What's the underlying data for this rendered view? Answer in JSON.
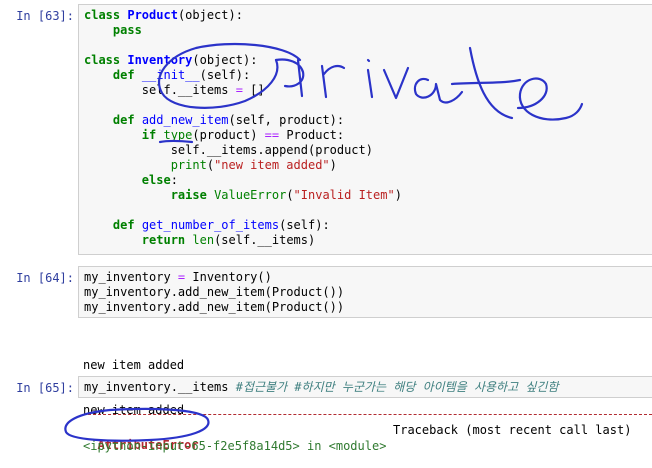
{
  "cells": [
    {
      "prompt": "In [63]:",
      "lines": [
        [
          [
            "kw",
            "class"
          ],
          [
            "",
            " "
          ],
          [
            "cls",
            "Product"
          ],
          [
            "",
            "(object):"
          ]
        ],
        [
          [
            "",
            "    "
          ],
          [
            "kw",
            "pass"
          ]
        ],
        [
          [
            "",
            ""
          ]
        ],
        [
          [
            "kw",
            "class"
          ],
          [
            "",
            " "
          ],
          [
            "cls",
            "Inventory"
          ],
          [
            "",
            "(object):"
          ]
        ],
        [
          [
            "",
            "    "
          ],
          [
            "kw",
            "def"
          ],
          [
            "",
            " "
          ],
          [
            "mg",
            "__init__"
          ],
          [
            "",
            "(self):"
          ]
        ],
        [
          [
            "",
            "        self.__items "
          ],
          [
            "op",
            "="
          ],
          [
            "",
            " []"
          ]
        ],
        [
          [
            "",
            ""
          ]
        ],
        [
          [
            "",
            "    "
          ],
          [
            "kw",
            "def"
          ],
          [
            "",
            " "
          ],
          [
            "fn",
            "add_new_item"
          ],
          [
            "",
            "(self, product):"
          ]
        ],
        [
          [
            "",
            "        "
          ],
          [
            "kw",
            "if"
          ],
          [
            "",
            " "
          ],
          [
            "bi",
            "type"
          ],
          [
            "",
            "(product) "
          ],
          [
            "op",
            "=="
          ],
          [
            "",
            " Product:"
          ]
        ],
        [
          [
            "",
            "            self.__items.append(product)"
          ]
        ],
        [
          [
            "",
            "            "
          ],
          [
            "bi",
            "print"
          ],
          [
            "",
            "("
          ],
          [
            "str",
            "\"new item added\""
          ],
          [
            "",
            ")"
          ]
        ],
        [
          [
            "",
            "        "
          ],
          [
            "kw",
            "else"
          ],
          [
            "",
            ":"
          ]
        ],
        [
          [
            "",
            "            "
          ],
          [
            "kw",
            "raise"
          ],
          [
            "",
            " "
          ],
          [
            "bi",
            "ValueError"
          ],
          [
            "",
            "("
          ],
          [
            "str",
            "\"Invalid Item\""
          ],
          [
            "",
            ")"
          ]
        ],
        [
          [
            "",
            ""
          ]
        ],
        [
          [
            "",
            "    "
          ],
          [
            "kw",
            "def"
          ],
          [
            "",
            " "
          ],
          [
            "fn",
            "get_number_of_items"
          ],
          [
            "",
            "(self):"
          ]
        ],
        [
          [
            "",
            "        "
          ],
          [
            "kw",
            "return"
          ],
          [
            "",
            " "
          ],
          [
            "bi",
            "len"
          ],
          [
            "",
            "(self.__items)"
          ]
        ]
      ]
    },
    {
      "prompt": "In [64]:",
      "lines": [
        [
          [
            "",
            "my_inventory "
          ],
          [
            "op",
            "="
          ],
          [
            "",
            " Inventory()"
          ]
        ],
        [
          [
            "",
            "my_inventory.add_new_item(Product())"
          ]
        ],
        [
          [
            "",
            "my_inventory.add_new_item(Product())"
          ]
        ]
      ]
    },
    {
      "prompt": "In [65]:",
      "lines": [
        [
          [
            "",
            "my_inventory.__items "
          ],
          [
            "cm",
            "#접근불가 #하지만 누군가는 해당 아이템을 사용하고 싶긴함"
          ]
        ]
      ]
    }
  ],
  "output_64": [
    "new item added",
    "new item added"
  ],
  "traceback": {
    "error_name": "AttributeError",
    "header_right": "Traceback (most recent call last)",
    "next_line": "<ipython-input-65-f2e5f8a14d5> in <module>"
  },
  "colors": {
    "prompt": "#303f9f",
    "annotation_ink": "#2b33c9",
    "error": "#b22b31"
  }
}
